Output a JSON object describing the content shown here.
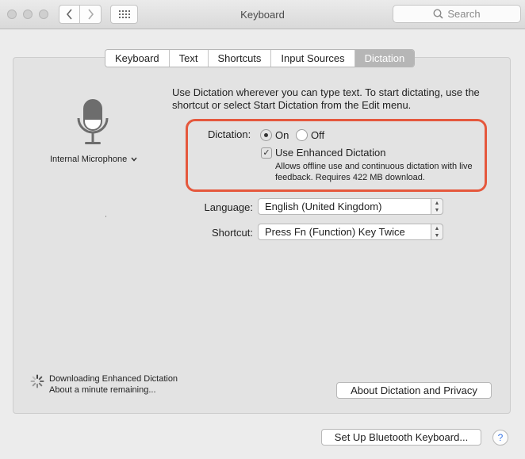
{
  "window": {
    "title": "Keyboard"
  },
  "toolbar": {
    "back_glyph": "‹",
    "forward_glyph": "›",
    "search_placeholder": "Search"
  },
  "tabs": [
    {
      "label": "Keyboard",
      "active": false
    },
    {
      "label": "Text",
      "active": false
    },
    {
      "label": "Shortcuts",
      "active": false
    },
    {
      "label": "Input Sources",
      "active": false
    },
    {
      "label": "Dictation",
      "active": true
    }
  ],
  "microphone": {
    "label": "Internal Microphone",
    "icon": "microphone-icon"
  },
  "intro_text": "Use Dictation wherever you can type text. To start dictating, use the shortcut or select Start Dictation from the Edit menu.",
  "dictation": {
    "label": "Dictation:",
    "on_label": "On",
    "off_label": "Off",
    "selected": "On",
    "enhanced_label": "Use Enhanced Dictation",
    "enhanced_checked": true,
    "enhanced_desc": "Allows offline use and continuous dictation with live feedback. Requires 422 MB download."
  },
  "language": {
    "label": "Language:",
    "value": "English (United Kingdom)"
  },
  "shortcut": {
    "label": "Shortcut:",
    "value": "Press Fn (Function) Key Twice"
  },
  "download": {
    "line1": "Downloading Enhanced Dictation",
    "line2": "About a minute remaining..."
  },
  "buttons": {
    "about": "About Dictation and Privacy",
    "bluetooth": "Set Up Bluetooth Keyboard...",
    "help": "?"
  },
  "colors": {
    "highlight": "#e5583d",
    "active_tab": "#b6b6b6"
  }
}
